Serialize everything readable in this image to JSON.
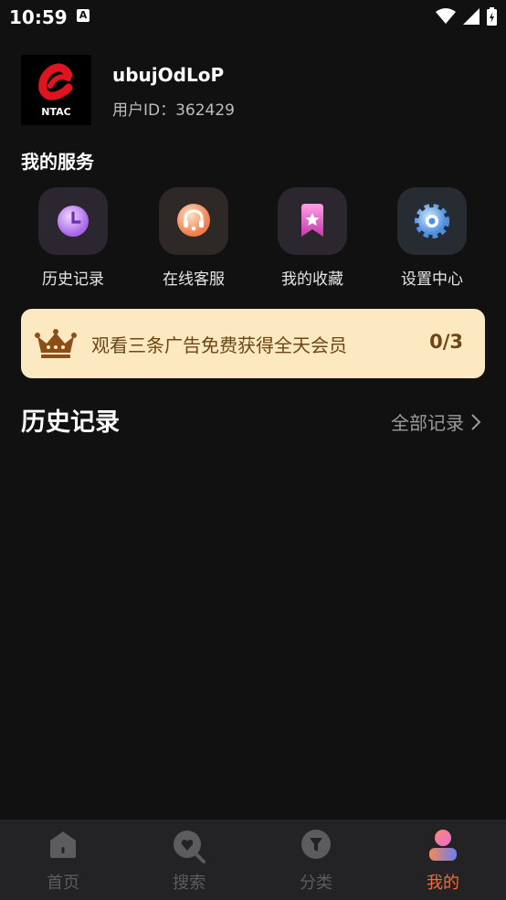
{
  "status_bar": {
    "time": "10:59",
    "notification_letter": "A"
  },
  "profile": {
    "avatar_label": "NTAC",
    "username": "ubujOdLoP",
    "user_id": "用户ID：362429"
  },
  "services": {
    "title": "我的服务",
    "items": [
      {
        "label": "历史记录",
        "icon": "clock-icon"
      },
      {
        "label": "在线客服",
        "icon": "headset-icon"
      },
      {
        "label": "我的收藏",
        "icon": "bookmark-star-icon"
      },
      {
        "label": "设置中心",
        "icon": "gear-icon"
      }
    ]
  },
  "banner": {
    "text": "观看三条广告免费获得全天会员",
    "progress": "0/3",
    "icon": "crown-icon"
  },
  "history": {
    "title": "历史记录",
    "all_link": "全部记录"
  },
  "tabbar": {
    "items": [
      {
        "label": "首页",
        "icon": "home-icon",
        "active": false
      },
      {
        "label": "搜索",
        "icon": "search-icon",
        "active": false
      },
      {
        "label": "分类",
        "icon": "category-icon",
        "active": false
      },
      {
        "label": "我的",
        "icon": "profile-icon",
        "active": true
      }
    ]
  },
  "colors": {
    "background": "#111112",
    "banner_bg": "#fde9c1",
    "banner_text": "#6e4513",
    "accent": "#f26b38",
    "tab_inactive": "#5c5c5e"
  }
}
